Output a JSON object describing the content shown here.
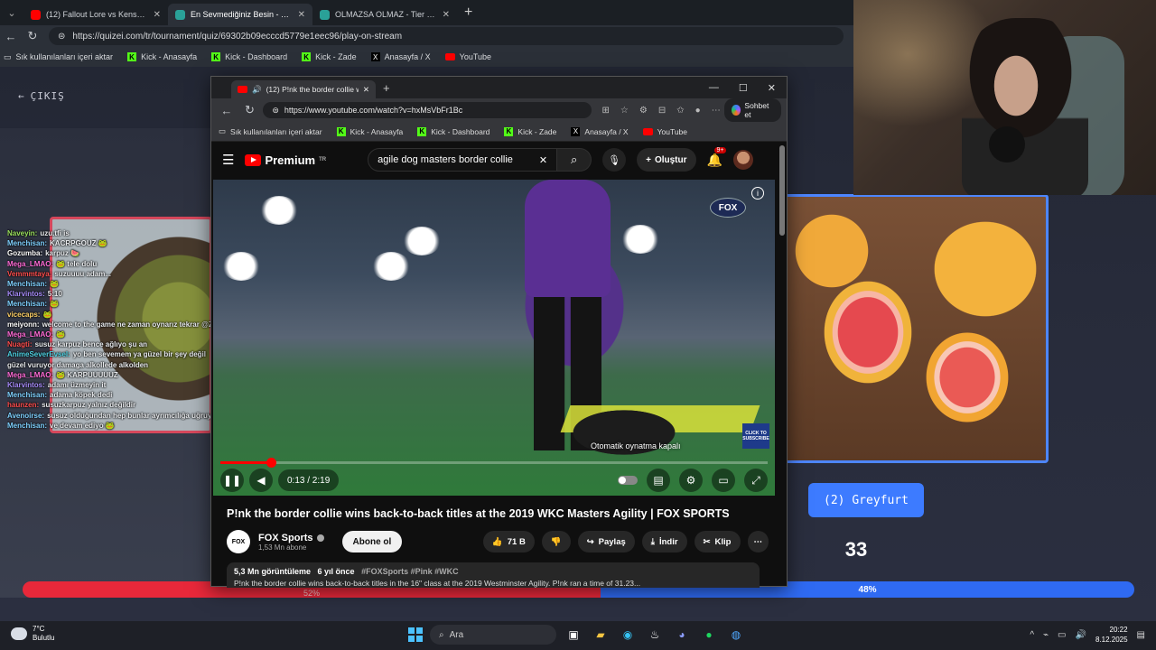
{
  "outer_browser": {
    "tabs": [
      {
        "label": "(12) Fallout Lore vs Kenshi Lore - ",
        "color": "#ff0000"
      },
      {
        "label": "En Sevmediğiniz Besin - Tier List, I",
        "color": "#2aa198"
      },
      {
        "label": "OLMAZSA OLMAZ - Tier List | Kör",
        "color": "#2aa198"
      }
    ],
    "url": "https://quizei.com/tr/tournament/quiz/69302b09ecccd5779e1eec96/play-on-stream",
    "bookmarks": {
      "import": "Sık kullanılanları içeri aktar",
      "items": [
        "Kick - Anasayfa",
        "Kick - Dashboard",
        "Kick - Zade"
      ],
      "x": "Anasayfa / X",
      "youtube": "YouTube"
    }
  },
  "quiz": {
    "exit_label": "ÇIKIŞ",
    "option_label": "(2) Greyfurt",
    "countdown": "33",
    "vote_left_percent": 52,
    "vote_left_label": "52%",
    "vote_right_label": "48%",
    "colors": {
      "left": "#e8283a",
      "right": "#2f6af2",
      "accent": "#3d7bff"
    }
  },
  "chat": [
    {
      "user": "Naveyin:",
      "color": "#9be15d",
      "text": "uzu.tfi is"
    },
    {
      "user": "Menchisan:",
      "color": "#7fd1ff",
      "text": "KACRPGOUZ 🐸"
    },
    {
      "user": "Gozumba:",
      "color": "#ffffff",
      "text": "karpuz 🍉"
    },
    {
      "user": "Mega_LMAO:",
      "color": "#ff6bd6",
      "text": "🐸 tele dolu"
    },
    {
      "user": "Vemmmtaya:",
      "color": "#ff4d4d",
      "text": "suzuuuu adam..."
    },
    {
      "user": "Menchisan:",
      "color": "#7fd1ff",
      "text": "🐸"
    },
    {
      "user": "Klarvintos:",
      "color": "#a78bfa",
      "text": "5:10"
    },
    {
      "user": "Menchisan:",
      "color": "#7fd1ff",
      "text": "🐸"
    },
    {
      "user": "vicecaps:",
      "color": "#ffd166",
      "text": "🐸"
    },
    {
      "user": "meiyonn:",
      "color": "#ffffff",
      "text": "welcome to the game ne zaman oynarız tekrar @Zade"
    },
    {
      "user": "Mega_LMAO:",
      "color": "#ff6bd6",
      "text": "🐸"
    },
    {
      "user": "Nuagti:",
      "color": "#ff4d4d",
      "text": "susuz karpuz bence ağlıyo şu an"
    },
    {
      "user": "AnimeSeverEvsel:",
      "color": "#4dd0e1",
      "text": "yo ben sevemem ya güzel bir şey değil"
    },
    {
      "user": "",
      "color": "#ffffff",
      "text": "güzel vuruyor damaga alkollede alkolden"
    },
    {
      "user": "Mega_LMAO:",
      "color": "#ff6bd6",
      "text": "🐸 KARPUUUUUZ"
    },
    {
      "user": "Klarvintos:",
      "color": "#a78bfa",
      "text": "adamı üzmeyin it"
    },
    {
      "user": "Menchisan:",
      "color": "#7fd1ff",
      "text": "adama köpek dedi"
    },
    {
      "user": "haunzen:",
      "color": "#ff4d4d",
      "text": "susuzkarpuz yalnız değildir"
    },
    {
      "user": "Avenoirse:",
      "color": "#7fd1ff",
      "text": "susuz olduğundan hep bunlar ayrımcılığa uğruyorsun"
    },
    {
      "user": "Menchisan:",
      "color": "#7fd1ff",
      "text": "ve devam ediyo 🐸"
    }
  ],
  "youtube_window": {
    "tab_title": "(12) P!nk the border collie wi",
    "url": "https://www.youtube.com/watch?v=hxMsVbFr1Bc",
    "sohbet": "Sohbet et",
    "bookmarks": {
      "import": "Sık kullanılanları içeri aktar",
      "items": [
        "Kick - Anasayfa",
        "Kick - Dashboard",
        "Kick - Zade"
      ],
      "x": "Anasayfa / X",
      "youtube": "YouTube"
    },
    "brand": "Premium",
    "brand_sup": "TR",
    "search_query": "agile dog masters border collie",
    "create_label": "Oluştur",
    "notif_badge": "9+",
    "player": {
      "time": "0:13 / 2:19",
      "progress_fraction": 0.093,
      "autoplay_tip": "Otomatik oynatma kapalı",
      "fox_bug": "FOX",
      "click_badge": "CLICK TO SUBSCRIBE"
    },
    "video_title": "P!nk the border collie wins back-to-back titles at the 2019 WKC Masters Agility | FOX SPORTS",
    "channel": {
      "name": "FOX Sports",
      "subs": "1,53 Mn abone",
      "logo": "FOX",
      "subscribe": "Abone ol"
    },
    "actions": {
      "likes": "71 B",
      "share": "Paylaş",
      "download": "İndir",
      "clip": "Klip"
    },
    "description": {
      "views": "5,3 Mn görüntüleme",
      "age": "6 yıl önce",
      "tags": "#FOXSports #Pink #WKC",
      "text": "P!nk the border collie wins back-to-back titles in the 16\" class at the 2019 Westminster Agility. P!nk ran a time of 31.23..."
    }
  },
  "taskbar": {
    "weather_temp": "7°C",
    "weather_desc": "Bulutlu",
    "search_placeholder": "Ara",
    "time": "20:22",
    "date": "8.12.2025"
  }
}
